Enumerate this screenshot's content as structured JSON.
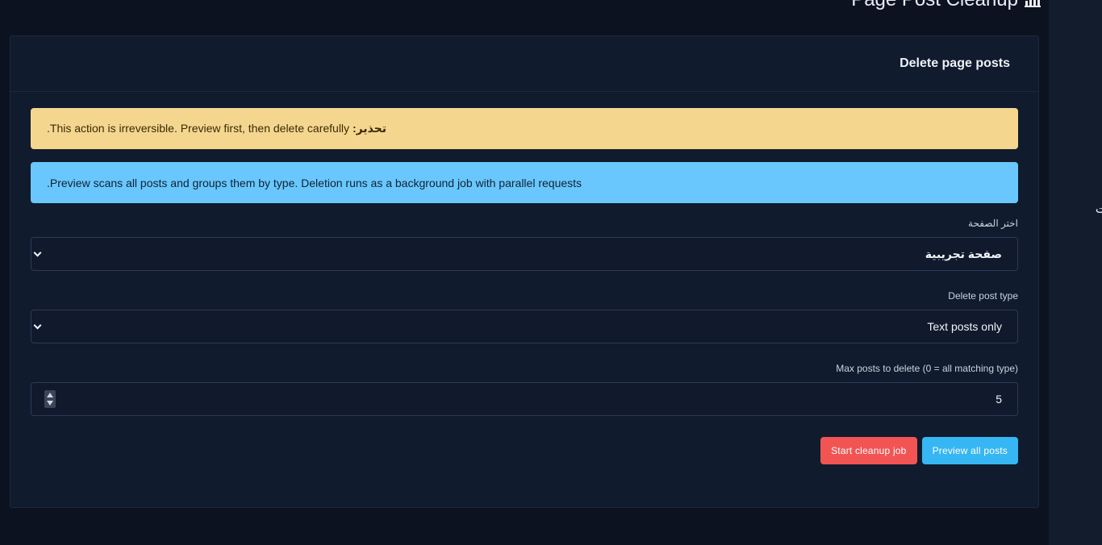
{
  "header": {
    "title": "Page Post Cleanup",
    "icon": "bar-chart-icon"
  },
  "sidebar": {
    "partial_label": "ت"
  },
  "card": {
    "title": "Delete page posts"
  },
  "alerts": {
    "warning": {
      "label": "تحذير:",
      "text": "This action is irreversible. Preview first, then delete carefully."
    },
    "info": {
      "text": "Preview scans all posts and groups them by type. Deletion runs as a background job with parallel requests."
    }
  },
  "form": {
    "page_select": {
      "label": "اختر الصفحة",
      "value": "صفحة تجريبية"
    },
    "post_type": {
      "label": "Delete post type",
      "value": "Text posts only"
    },
    "max_posts": {
      "label": "Max posts to delete (0 = all matching type)",
      "value": "5"
    }
  },
  "buttons": {
    "start": "Start cleanup job",
    "preview": "Preview all posts"
  },
  "colors": {
    "background": "#0c1220",
    "card": "#111b2e",
    "warning": "#f5d68f",
    "info": "#69c7fd",
    "danger": "#f25454",
    "primary": "#36b6f3"
  }
}
